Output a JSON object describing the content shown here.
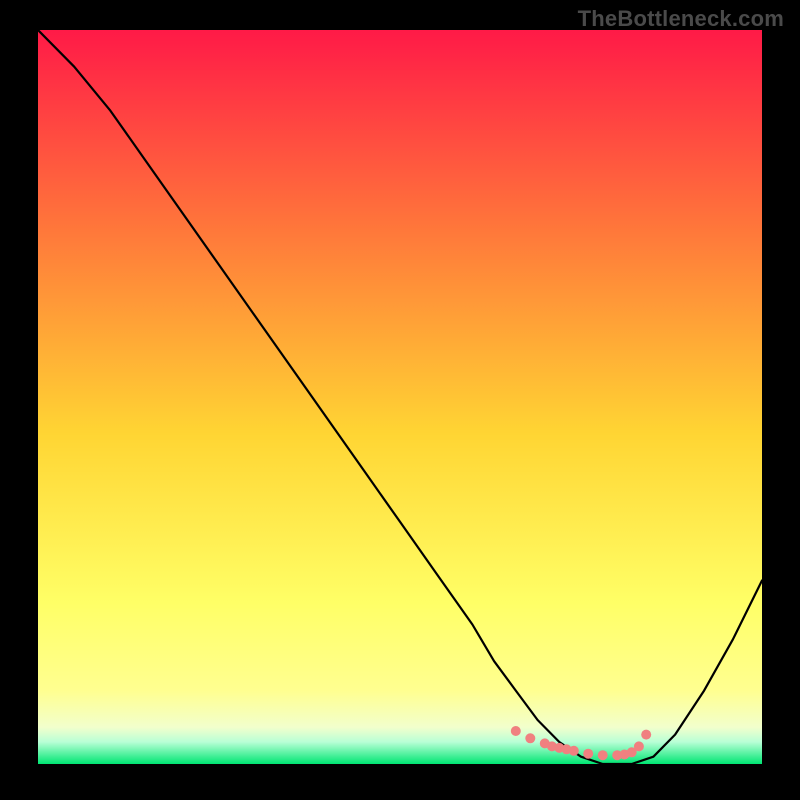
{
  "watermark": "TheBottleneck.com",
  "colors": {
    "background": "#000000",
    "grad_top": "#ff1a47",
    "grad_mid1": "#ff7a3a",
    "grad_mid2": "#ffd533",
    "grad_low": "#ffff66",
    "grad_bottom_pale": "#f2ffcc",
    "grad_bottom_green": "#00e673",
    "curve": "#000000",
    "dots": "#f08080"
  },
  "chart_data": {
    "type": "line",
    "title": "",
    "xlabel": "",
    "ylabel": "",
    "xlim": [
      0,
      100
    ],
    "ylim": [
      0,
      100
    ],
    "legend": false,
    "grid": false,
    "series": [
      {
        "name": "bottleneck-curve",
        "x": [
          0,
          5,
          10,
          15,
          20,
          25,
          30,
          35,
          40,
          45,
          50,
          55,
          60,
          63,
          66,
          69,
          72,
          75,
          78,
          80,
          82,
          85,
          88,
          92,
          96,
          100
        ],
        "y": [
          100,
          95,
          89,
          82,
          75,
          68,
          61,
          54,
          47,
          40,
          33,
          26,
          19,
          14,
          10,
          6,
          3,
          1,
          0,
          0,
          0,
          1,
          4,
          10,
          17,
          25
        ]
      }
    ],
    "markers": {
      "name": "highlight-dots",
      "x": [
        66,
        68,
        70,
        71,
        72,
        73,
        74,
        76,
        78,
        80,
        81,
        82,
        83,
        84
      ],
      "y": [
        4.5,
        3.5,
        2.8,
        2.4,
        2.2,
        2.0,
        1.8,
        1.4,
        1.2,
        1.2,
        1.3,
        1.6,
        2.4,
        4.0
      ]
    }
  }
}
